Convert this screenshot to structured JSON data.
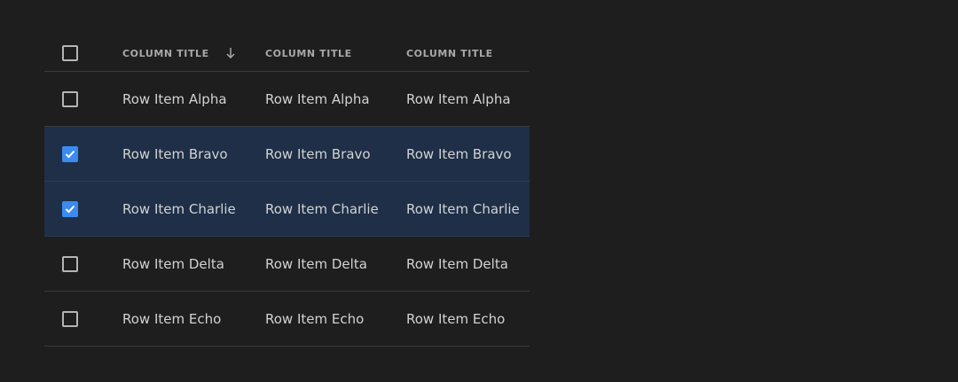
{
  "header": {
    "columns": [
      "COLUMN TITLE",
      "COLUMN TITLE",
      "COLUMN TITLE"
    ],
    "sorted_column": 0,
    "sort_direction": "descending",
    "select_all_checked": false
  },
  "rows": [
    {
      "checked": false,
      "cells": [
        "Row Item Alpha",
        "Row Item Alpha",
        "Row Item Alpha"
      ]
    },
    {
      "checked": true,
      "cells": [
        "Row Item Bravo",
        "Row Item Bravo",
        "Row Item Bravo"
      ]
    },
    {
      "checked": true,
      "cells": [
        "Row Item Charlie",
        "Row Item Charlie",
        "Row Item Charlie"
      ]
    },
    {
      "checked": false,
      "cells": [
        "Row Item Delta",
        "Row Item Delta",
        "Row Item Delta"
      ]
    },
    {
      "checked": false,
      "cells": [
        "Row Item Echo",
        "Row Item Echo",
        "Row Item Echo"
      ]
    }
  ],
  "icons": {
    "sort": "arrow-down-icon",
    "check": "checkmark-icon"
  },
  "colors": {
    "background": "#1e1e1e",
    "selected_row": "#1e2f47",
    "checkbox_accent": "#3b8bf0",
    "divider": "#3a3a3a"
  }
}
